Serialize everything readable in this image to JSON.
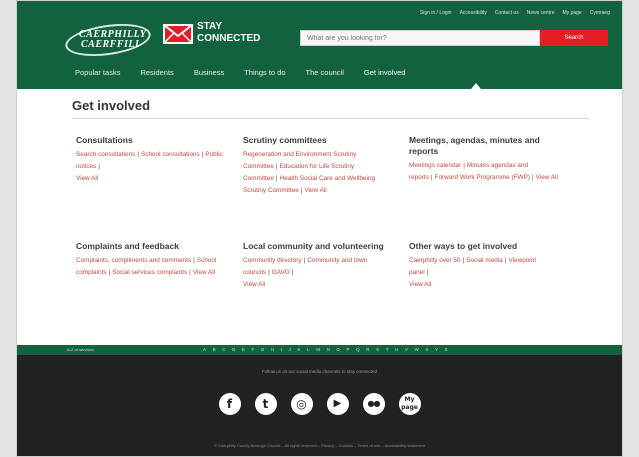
{
  "brand": {
    "logo_line1": "CAERPHILLY",
    "logo_line2": "CAERFFILI",
    "stay_line1": "STAY",
    "stay_line2": "CONNECTED"
  },
  "top_links": [
    "Sign in / Login",
    "Accessibility",
    "Contact us",
    "News centre",
    "My page",
    "Cymraeg"
  ],
  "search": {
    "placeholder": "What are you looking for?",
    "button_label": "Search"
  },
  "nav": {
    "items": [
      "Popular tasks",
      "Residents",
      "Business",
      "Things to do",
      "The council",
      "Get involved"
    ],
    "active": "Get involved"
  },
  "page_title": "Get involved",
  "sections": [
    {
      "heading": "Consultations",
      "links": [
        "Search consultations",
        "School consultations",
        "Public notices",
        "View All"
      ]
    },
    {
      "heading": "Scrutiny committees",
      "links": [
        "Regeneration and Environment Scrutiny Committee",
        "Education for Life Scrutiny Committee",
        "Health Social Care and Wellbeing Scrutiny Committee",
        "View All"
      ]
    },
    {
      "heading": "Meetings, agendas, minutes and reports",
      "links": [
        "Meetings calendar",
        "Minutes agendas and reports",
        "Forward Work Programme (FWP)",
        "View All"
      ]
    },
    {
      "heading": "Complaints and feedback",
      "links": [
        "Complaints, compliments and comments",
        "School complaints",
        "Social services complaints",
        "View All"
      ]
    },
    {
      "heading": "Local community and volunteering",
      "links": [
        "Community directory",
        "Community and town councils",
        "GAVO",
        "View All"
      ]
    },
    {
      "heading": "Other ways to get involved",
      "links": [
        "Caerphilly over 50",
        "Social media",
        "Viewpoint panel",
        "View All"
      ]
    }
  ],
  "az": {
    "label": "A-Z of services",
    "letters": [
      "A",
      "B",
      "C",
      "D",
      "E",
      "F",
      "G",
      "H",
      "I",
      "J",
      "K",
      "L",
      "M",
      "N",
      "O",
      "P",
      "Q",
      "R",
      "S",
      "T",
      "U",
      "V",
      "W",
      "X",
      "Y",
      "Z"
    ]
  },
  "footer": {
    "note": "Follow us on our social media channels to stay connected",
    "social": [
      {
        "glyph": "f",
        "icon": "facebook-icon"
      },
      {
        "glyph": "t",
        "icon": "twitter-icon"
      },
      {
        "glyph": "◎",
        "icon": "instagram-icon"
      },
      {
        "glyph": "▶",
        "icon": "youtube-icon"
      },
      {
        "glyph": "●●",
        "icon": "flickr-icon"
      },
      {
        "glyph": "My page",
        "icon": "mypage-icon"
      }
    ],
    "copyright": "© Caerphilly County Borough Council – All rights reserved – Privacy – Cookies – Terms of use – Accessibility statement"
  },
  "colors": {
    "brand_green": "#12613f",
    "accent_red": "#e31e24",
    "link_red": "#c24a3f",
    "footer_dark": "#222222"
  }
}
